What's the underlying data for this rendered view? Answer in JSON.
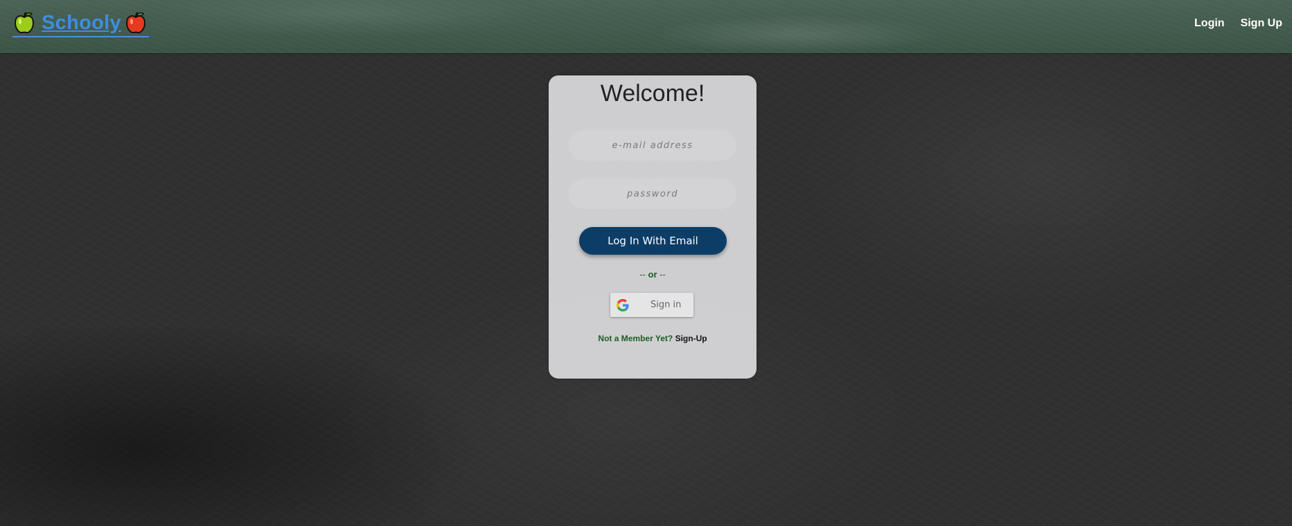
{
  "navbar": {
    "brand": "Schooly",
    "links": [
      "Login",
      "Sign Up"
    ]
  },
  "card": {
    "title": "Welcome!",
    "email_placeholder": "e-mail address",
    "password_placeholder": "password",
    "login_button": "Log In With Email",
    "or_prefix": "-- ",
    "or_word": "or",
    "or_suffix": " --",
    "google_button": "Sign in",
    "signup_prompt": "Not a Member Yet?",
    "signup_link": "Sign-Up"
  },
  "icons": {
    "left": "green-apple-icon",
    "right": "red-apple-icon",
    "google": "google-g-icon"
  },
  "colors": {
    "brand_text": "#3d8ee0",
    "primary_button": "#0c3d67",
    "accent_green": "#1b5e20",
    "navbar": "#3b5446",
    "background": "#2f2f2f"
  }
}
